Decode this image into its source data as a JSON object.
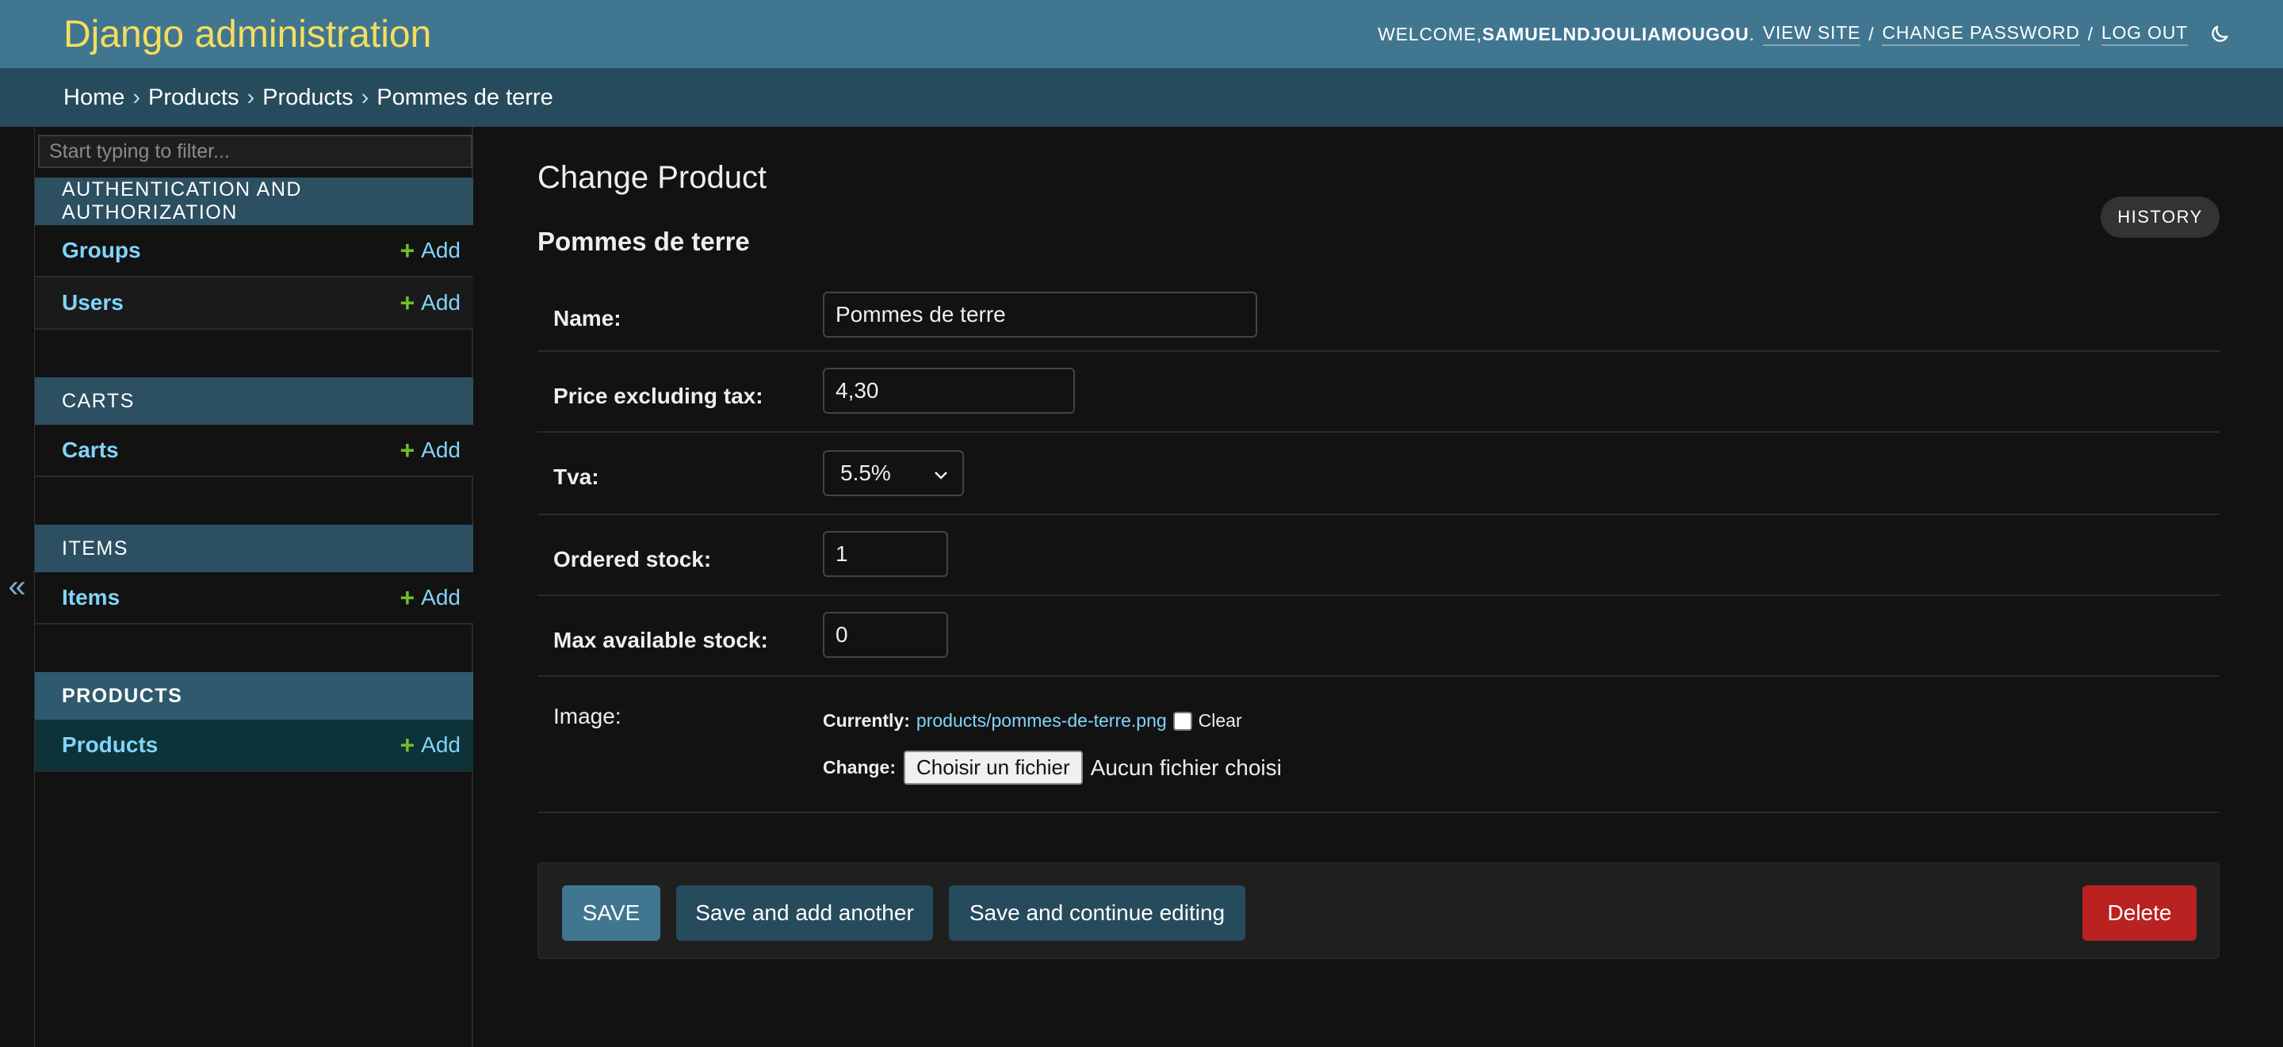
{
  "header": {
    "site_name": "Django administration",
    "welcome": "WELCOME, ",
    "username": "SAMUELNDJOULIAMOUGOU",
    "after_username": ".",
    "view_site": "VIEW SITE",
    "change_password": "CHANGE PASSWORD",
    "log_out": "LOG OUT",
    "separator": "/",
    "theme_icon": "moon-icon"
  },
  "breadcrumbs": {
    "items": [
      "Home",
      "Products",
      "Products",
      "Pommes de terre"
    ],
    "separator": "›"
  },
  "sidebar": {
    "toggle_symbol": "«",
    "filter_placeholder": "Start typing to filter...",
    "add_label": "Add",
    "modules": [
      {
        "caption": "AUTHENTICATION AND AUTHORIZATION",
        "models": [
          "Groups",
          "Users"
        ]
      },
      {
        "caption": "CARTS",
        "models": [
          "Carts"
        ]
      },
      {
        "caption": "ITEMS",
        "models": [
          "Items"
        ]
      },
      {
        "caption": "PRODUCTS",
        "models": [
          "Products"
        ]
      }
    ]
  },
  "content": {
    "title": "Change Product",
    "object_title": "Pommes de terre",
    "history_label": "HISTORY",
    "fields": {
      "name": {
        "label": "Name:",
        "value": "Pommes de terre"
      },
      "price": {
        "label": "Price excluding tax:",
        "value": "4,30"
      },
      "tva": {
        "label": "Tva:",
        "value": "5.5%"
      },
      "ordered_stock": {
        "label": "Ordered stock:",
        "value": "1"
      },
      "max_stock": {
        "label": "Max available stock:",
        "value": "0"
      },
      "image": {
        "label": "Image:",
        "currently_label": "Currently:",
        "current_file": "products/pommes-de-terre.png",
        "clear_label": "Clear",
        "change_label": "Change:",
        "choose_button": "Choisir un fichier",
        "no_file": "Aucun fichier choisi"
      }
    },
    "buttons": {
      "save": "SAVE",
      "save_add_another": "Save and add another",
      "save_continue": "Save and continue editing",
      "delete": "Delete"
    }
  },
  "colors": {
    "header_bg": "#417690",
    "breadcrumbs_bg": "#264b5d",
    "site_name": "#f5dd5d",
    "link": "#81d4fa",
    "add_plus": "#70bf2b",
    "delete": "#ba2121"
  }
}
